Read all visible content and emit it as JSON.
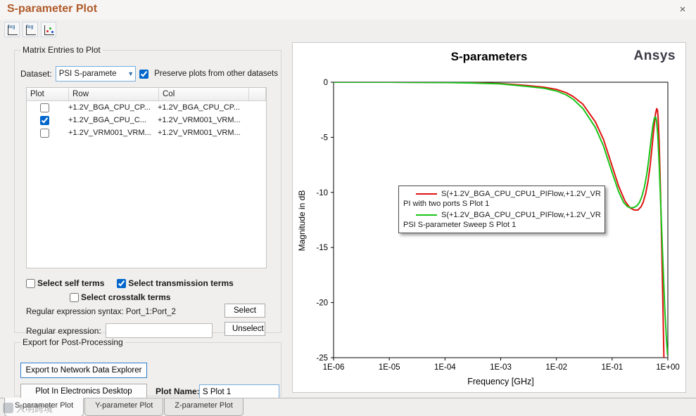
{
  "window": {
    "title": "S-parameter Plot",
    "close_glyph": "×"
  },
  "toolbar": {
    "log_text": "log"
  },
  "matrix": {
    "title": "Matrix Entries to Plot",
    "dataset_label": "Dataset:",
    "dataset_value": "PSI S-paramete",
    "preserve_label": "Preserve plots from other datasets",
    "preserve_checked": true,
    "table": {
      "columns": [
        "Plot",
        "Row",
        "Col"
      ],
      "rows": [
        {
          "checked": false,
          "row": "+1.2V_BGA_CPU_CP...",
          "col": "+1.2V_BGA_CPU_CP..."
        },
        {
          "checked": true,
          "row": "+1.2V_BGA_CPU_C...",
          "col": "+1.2V_VRM001_VRM..."
        },
        {
          "checked": false,
          "row": "+1.2V_VRM001_VRM...",
          "col": "+1.2V_VRM001_VRM..."
        }
      ]
    },
    "self_terms_label": "Select self terms",
    "self_terms_checked": false,
    "transmission_label": "Select transmission terms",
    "transmission_checked": true,
    "crosstalk_label": "Select crosstalk terms",
    "crosstalk_checked": false,
    "regex_syntax_label": "Regular expression syntax: Port_1:Port_2",
    "regex_label": "Regular expression:",
    "regex_value": "",
    "select_button": "Select",
    "unselect_button": "Unselect"
  },
  "export": {
    "title": "Export for Post-Processing",
    "network_button": "Export to Network Data Explorer",
    "desktop_button": "Plot In Electronics Desktop",
    "plot_name_label": "Plot Name:",
    "plot_name_value": "S Plot 1"
  },
  "tabs": [
    {
      "label": "S-parameter Plot",
      "active": true
    },
    {
      "label": "Y-parameter Plot",
      "active": false
    },
    {
      "label": "Z-parameter Plot",
      "active": false
    }
  ],
  "watermark": {
    "text": "大明跨境"
  },
  "chart_data": {
    "type": "line",
    "title": "S-parameters",
    "logo": "Ansys",
    "xlabel": "Frequency [GHz]",
    "ylabel": "Magnitude in dB",
    "x_scale": "log",
    "xlim": [
      1e-06,
      1
    ],
    "ylim": [
      -25,
      0
    ],
    "grid": false,
    "legend_position": "center",
    "x_ticks": {
      "values": [
        1e-06,
        1e-05,
        0.0001,
        0.001,
        0.01,
        0.1,
        1
      ],
      "labels": [
        "1E-06",
        "1E-05",
        "1E-04",
        "1E-03",
        "1E-02",
        "1E-01",
        "1E+00"
      ]
    },
    "y_ticks": {
      "values": [
        0,
        -5,
        -10,
        -15,
        -20,
        -25
      ],
      "labels": [
        "0",
        "-5",
        "-10",
        "-15",
        "-20",
        "-25"
      ]
    },
    "series": [
      {
        "name": "S(+1.2V_BGA_CPU_CPU1_PIFlow,+1.2V_VR...",
        "sublabel": "PI with two ports  S Plot 1",
        "color": "#e01212",
        "x": [
          1e-06,
          1e-05,
          0.0001,
          0.0003,
          0.001,
          0.003,
          0.006,
          0.01,
          0.015,
          0.02,
          0.03,
          0.05,
          0.07,
          0.1,
          0.13,
          0.17,
          0.21,
          0.25,
          0.29,
          0.33,
          0.36,
          0.4,
          0.44,
          0.48,
          0.52,
          0.56,
          0.6,
          0.63,
          0.65,
          0.67,
          0.7,
          0.74,
          0.78,
          0.82,
          0.85
        ],
        "y": [
          0,
          0,
          -0.02,
          -0.05,
          -0.12,
          -0.3,
          -0.45,
          -0.65,
          -0.95,
          -1.3,
          -2.0,
          -3.6,
          -5.2,
          -7.6,
          -9.4,
          -10.8,
          -11.4,
          -11.6,
          -11.6,
          -11.3,
          -10.9,
          -10.1,
          -9.0,
          -7.6,
          -5.9,
          -4.2,
          -2.9,
          -2.4,
          -2.5,
          -3.2,
          -5.5,
          -10.0,
          -15.5,
          -21.0,
          -25.0
        ]
      },
      {
        "name": "S(+1.2V_BGA_CPU_CPU1_PIFlow,+1.2V_VR...",
        "sublabel": "PSI S-parameter Sweep  S Plot 1",
        "color": "#18c418",
        "x": [
          1e-06,
          1e-05,
          0.0001,
          0.0003,
          0.001,
          0.003,
          0.006,
          0.01,
          0.015,
          0.02,
          0.03,
          0.05,
          0.07,
          0.1,
          0.13,
          0.16,
          0.19,
          0.22,
          0.25,
          0.28,
          0.31,
          0.34,
          0.38,
          0.42,
          0.46,
          0.5,
          0.54,
          0.57,
          0.59,
          0.61,
          0.63,
          0.66,
          0.7,
          0.75,
          0.81,
          0.88,
          0.95,
          0.99
        ],
        "y": [
          0,
          0,
          -0.03,
          -0.07,
          -0.15,
          -0.38,
          -0.55,
          -0.8,
          -1.15,
          -1.55,
          -2.4,
          -4.1,
          -5.8,
          -8.2,
          -9.9,
          -10.9,
          -11.3,
          -11.4,
          -11.35,
          -11.2,
          -10.9,
          -10.4,
          -9.5,
          -8.3,
          -6.8,
          -5.2,
          -3.9,
          -3.3,
          -3.15,
          -3.2,
          -3.6,
          -4.8,
          -7.5,
          -11.5,
          -16.0,
          -20.5,
          -23.5,
          -24.8
        ]
      }
    ]
  }
}
